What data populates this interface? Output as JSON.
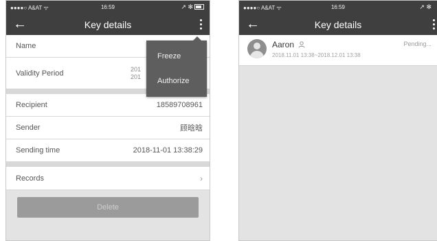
{
  "status_bar": {
    "carrier": "●●●●○ A&AT ᯤ",
    "time": "16:59",
    "right": "↗ ✻"
  },
  "left_screen": {
    "nav": {
      "title": "Key details",
      "back_icon": "arrow-left-icon",
      "more_icon": "vertical-dots-icon"
    },
    "rows": {
      "name_label": "Name",
      "validity_label": "Validity Period",
      "validity_value_1": "201",
      "validity_value_2": "201",
      "recipient_label": "Recipient",
      "recipient_value": "18589708961",
      "sender_label": "Sender",
      "sender_value": "顾晗晗",
      "sending_time_label": "Sending time",
      "sending_time_value": "2018-11-01 13:38:29",
      "records_label": "Records",
      "records_chevron": "›"
    },
    "delete_label": "Delete",
    "popup_menu": {
      "freeze": "Freeze",
      "authorize": "Authorize"
    }
  },
  "right_screen": {
    "nav": {
      "title": "Key details"
    },
    "key_item": {
      "name": "Aaron",
      "period": "2018.11.01 13:38~2018.12.01 13:38",
      "status": "Pending..."
    }
  }
}
